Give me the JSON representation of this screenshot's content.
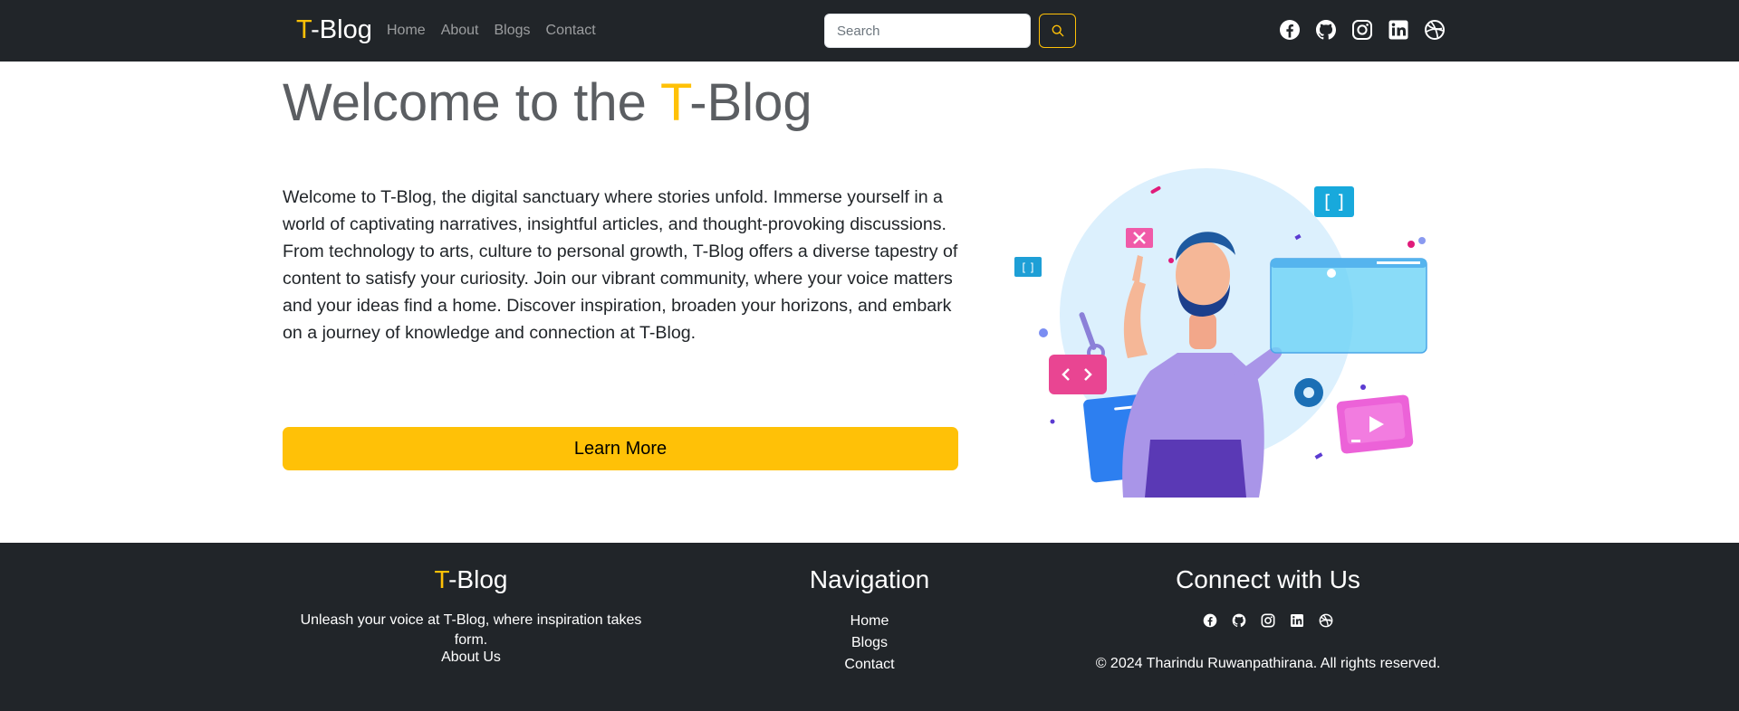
{
  "navbar": {
    "brand": {
      "accent": "T",
      "rest": "-Blog"
    },
    "links": [
      "Home",
      "About",
      "Blogs",
      "Contact"
    ],
    "search": {
      "placeholder": "Search",
      "button_icon": "search-icon"
    },
    "social_icons": [
      "facebook-icon",
      "github-icon",
      "instagram-icon",
      "linkedin-icon",
      "dribbble-icon"
    ]
  },
  "hero": {
    "title_prefix": "Welcome to the ",
    "title_accent": "T",
    "title_suffix": "-Blog",
    "description": "Welcome to T-Blog, the digital sanctuary where stories unfold. Immerse yourself in a world of captivating narratives, insightful articles, and thought-provoking discussions. From technology to arts, culture to personal growth, T-Blog offers a diverse tapestry of content to satisfy your curiosity. Join our vibrant community, where your voice matters and your ideas find a home. Discover inspiration, broaden your horizons, and embark on a journey of knowledge and connection at T-Blog.",
    "button_label": "Learn More",
    "illustration": "developer-illustration"
  },
  "footer": {
    "brand": {
      "accent": "T",
      "rest": "-Blog"
    },
    "tagline": "Unleash your voice at T-Blog, where inspiration takes form.",
    "about_link": "About Us",
    "nav_heading": "Navigation",
    "nav_links": [
      "Home",
      "Blogs",
      "Contact"
    ],
    "connect_heading": "Connect with Us",
    "social_icons": [
      "facebook-icon",
      "github-icon",
      "instagram-icon",
      "linkedin-icon",
      "dribbble-icon"
    ],
    "copyright": "© 2024 Tharindu Ruwanpathirana. All rights reserved."
  },
  "colors": {
    "navbar_bg": "#212529",
    "accent": "#ffc107",
    "title_text": "#5b5e62",
    "body_text": "#212529",
    "nav_link": "rgba(255,255,255,0.55)"
  }
}
